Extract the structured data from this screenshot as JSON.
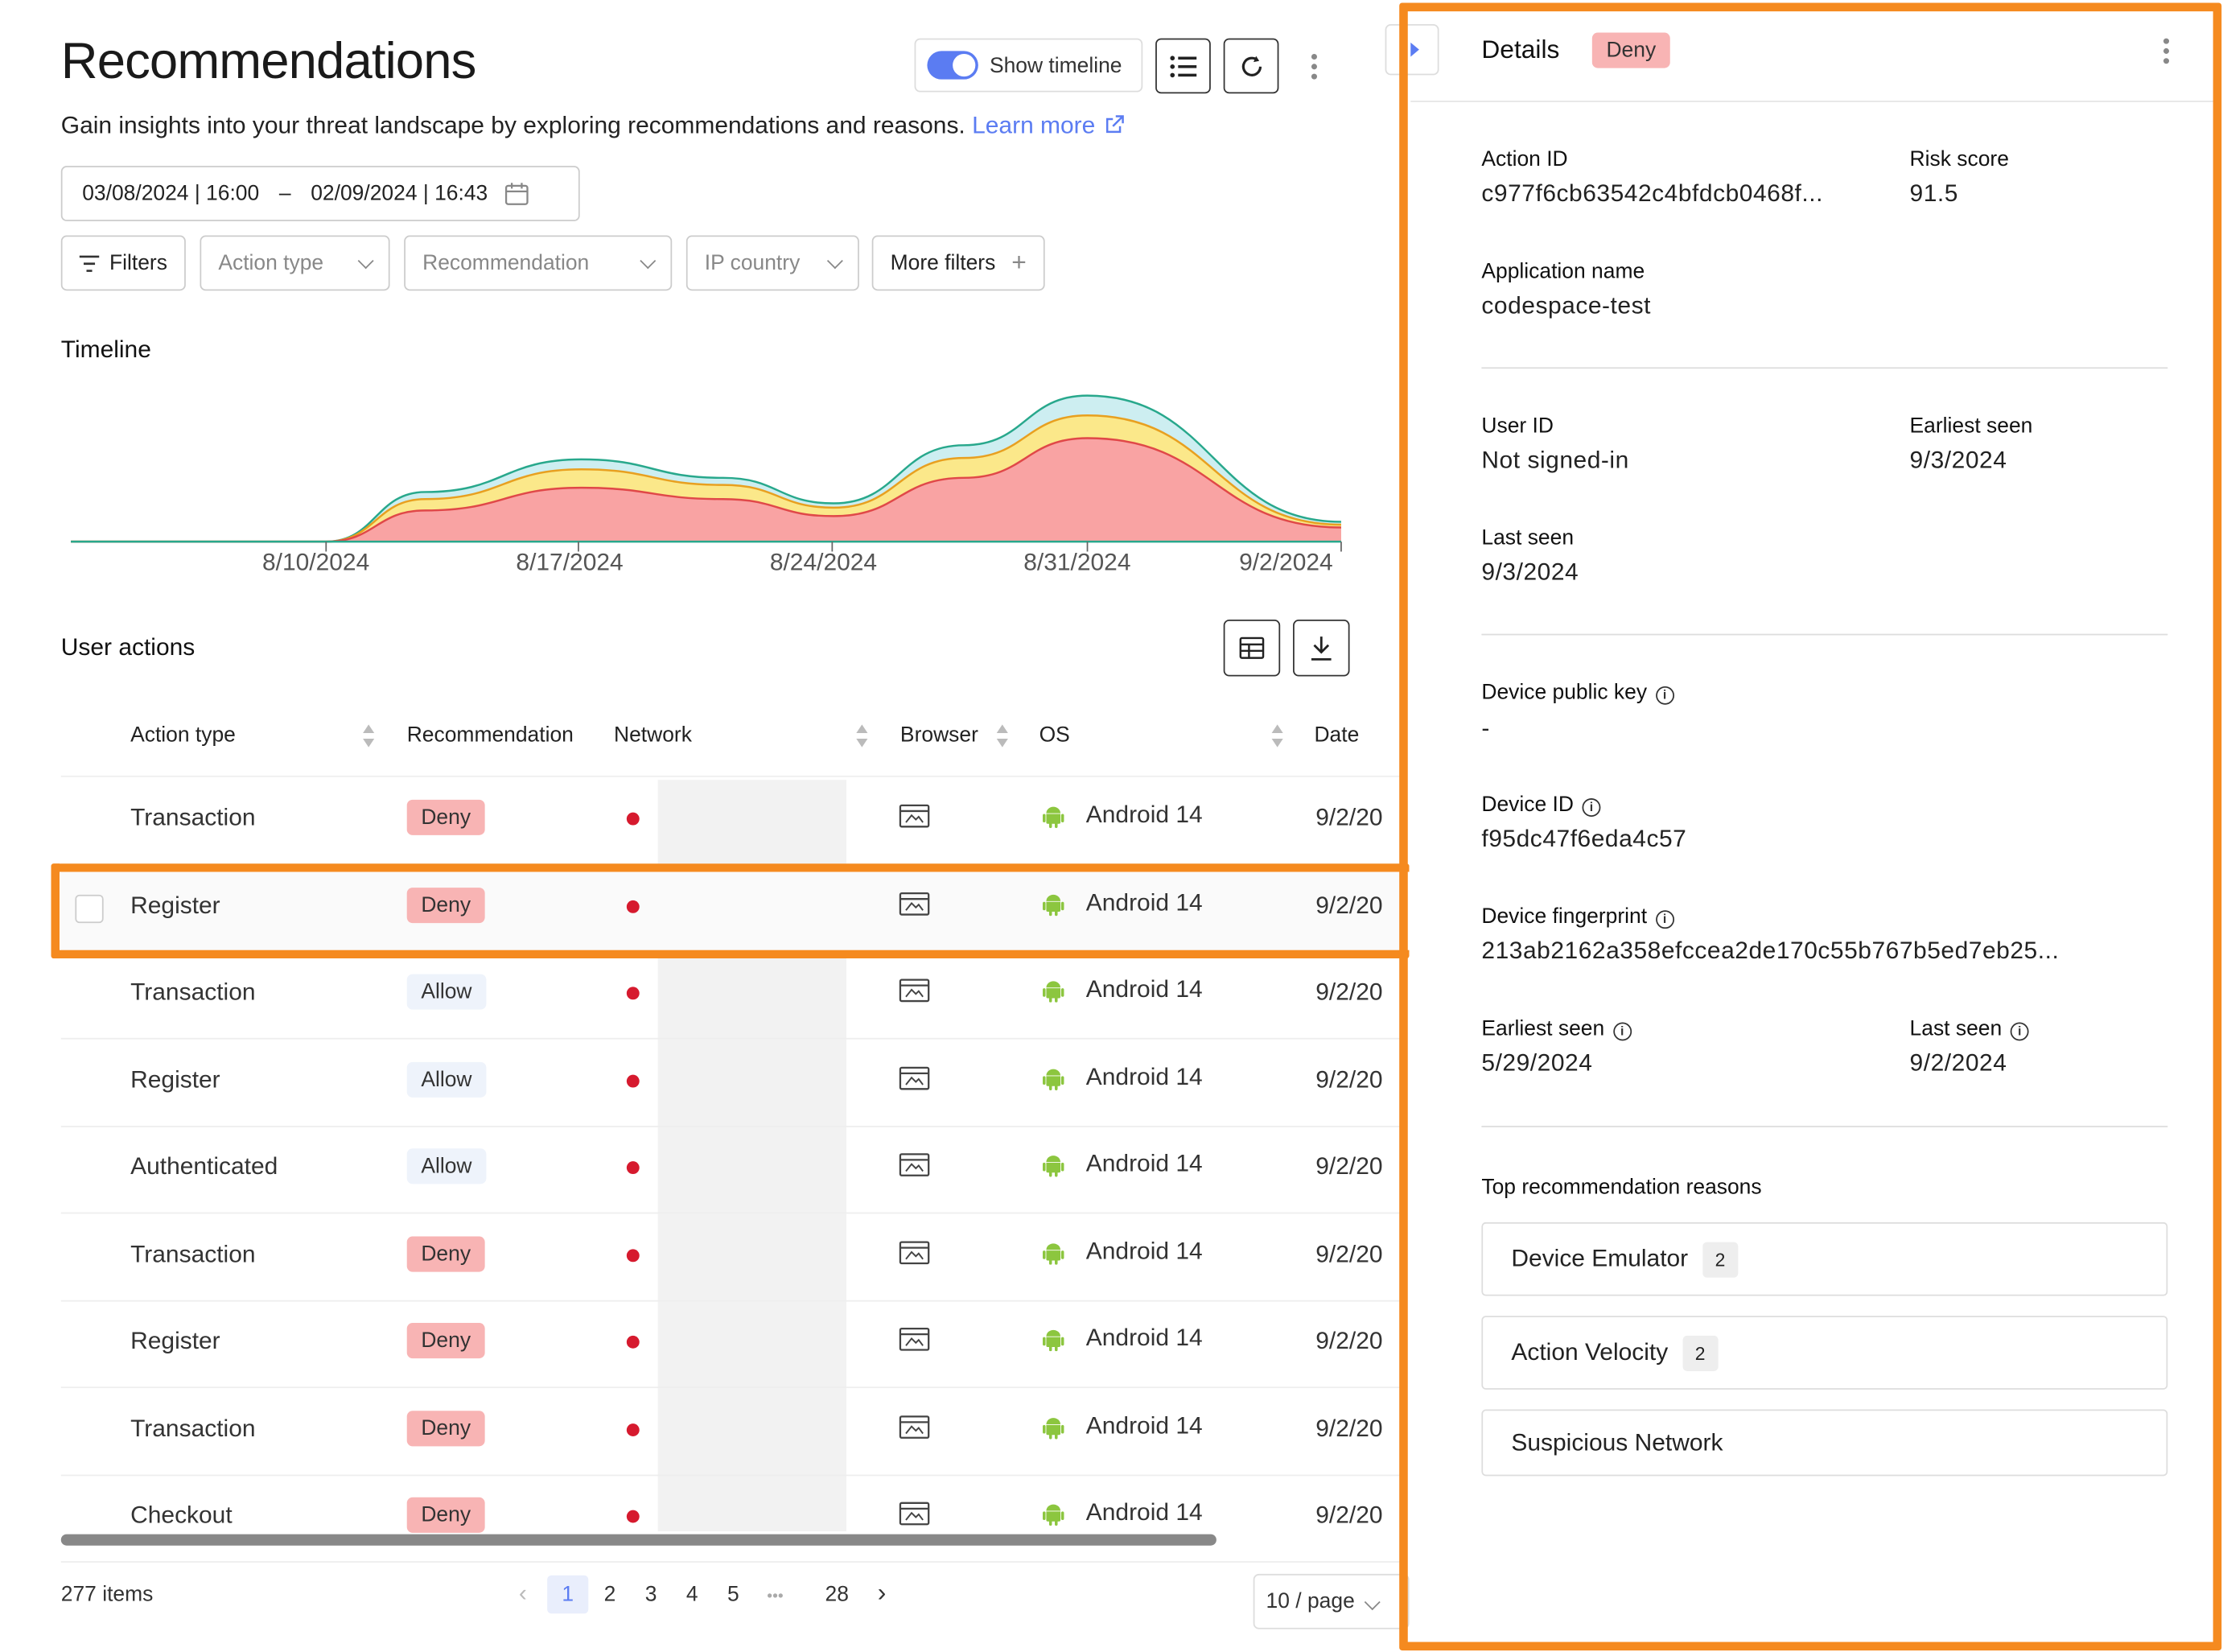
{
  "header": {
    "title": "Recommendations",
    "subtitle": "Gain insights into your threat landscape by exploring recommendations and reasons.",
    "learn_more": "Learn more",
    "show_timeline": "Show timeline"
  },
  "date_range": {
    "start": "03/08/2024 | 16:00",
    "separator": "–",
    "end": "02/09/2024 | 16:43"
  },
  "filters": {
    "filters_label": "Filters",
    "action_type": "Action type",
    "recommendation": "Recommendation",
    "ip_country": "IP country",
    "more_filters": "More filters"
  },
  "timeline": {
    "title": "Timeline",
    "ticks": [
      "8/10/2024",
      "8/17/2024",
      "8/24/2024",
      "8/31/2024",
      "9/2/2024"
    ]
  },
  "chart_data": {
    "type": "area",
    "x": [
      "8/3/2024",
      "8/10/2024",
      "8/13/2024",
      "8/17/2024",
      "8/20/2024",
      "8/24/2024",
      "8/27/2024",
      "8/31/2024",
      "9/2/2024"
    ],
    "series": [
      {
        "name": "",
        "color": "#f9a3a3",
        "values": [
          0,
          0,
          22,
          38,
          30,
          18,
          45,
          73,
          10
        ]
      },
      {
        "name": "",
        "color": "#fbe88a",
        "values": [
          0,
          0,
          8,
          13,
          10,
          6,
          14,
          16,
          2
        ]
      },
      {
        "name": "",
        "color": "#cdeef1",
        "values": [
          0,
          0,
          5,
          7,
          5,
          3,
          9,
          14,
          2
        ]
      }
    ],
    "stroke_colors": {
      "top": "#28a88c",
      "mid": "#e8a020",
      "bottom": "#e04848"
    }
  },
  "user_actions": {
    "title": "User actions",
    "columns": {
      "action_type": "Action type",
      "recommendation": "Recommendation",
      "network": "Network",
      "browser": "Browser",
      "os": "OS",
      "date": "Date"
    },
    "rows": [
      {
        "action": "Transaction",
        "rec": "Deny",
        "os": "Android 14",
        "date": "9/2/20"
      },
      {
        "action": "Register",
        "rec": "Deny",
        "os": "Android 14",
        "date": "9/2/20"
      },
      {
        "action": "Transaction",
        "rec": "Allow",
        "os": "Android 14",
        "date": "9/2/20"
      },
      {
        "action": "Register",
        "rec": "Allow",
        "os": "Android 14",
        "date": "9/2/20"
      },
      {
        "action": "Authenticated",
        "rec": "Allow",
        "os": "Android 14",
        "date": "9/2/20"
      },
      {
        "action": "Transaction",
        "rec": "Deny",
        "os": "Android 14",
        "date": "9/2/20"
      },
      {
        "action": "Register",
        "rec": "Deny",
        "os": "Android 14",
        "date": "9/2/20"
      },
      {
        "action": "Transaction",
        "rec": "Deny",
        "os": "Android 14",
        "date": "9/2/20"
      },
      {
        "action": "Checkout",
        "rec": "Deny",
        "os": "Android 14",
        "date": "9/2/20"
      }
    ]
  },
  "pagination": {
    "items": "277 items",
    "pages": [
      "1",
      "2",
      "3",
      "4",
      "5",
      "•••",
      "28"
    ],
    "per_page": "10 / page"
  },
  "details": {
    "title": "Details",
    "badge": "Deny",
    "action_id_label": "Action ID",
    "action_id": "c977f6cb63542c4bfdcb0468f...",
    "risk_score_label": "Risk score",
    "risk_score": "91.5",
    "app_name_label": "Application name",
    "app_name": "codespace-test",
    "user_id_label": "User ID",
    "user_id": "Not signed-in",
    "earliest_seen_label": "Earliest seen",
    "earliest_seen": "9/3/2024",
    "last_seen_label": "Last seen",
    "last_seen": "9/3/2024",
    "device_public_key_label": "Device public key",
    "device_public_key": "-",
    "device_id_label": "Device ID",
    "device_id": "f95dc47f6eda4c57",
    "device_fp_label": "Device fingerprint",
    "device_fp": "213ab2162a358efccea2de170c55b767b5ed7eb25...",
    "dev_earliest_label": "Earliest seen",
    "dev_earliest": "5/29/2024",
    "dev_last_label": "Last seen",
    "dev_last": "9/2/2024",
    "reasons_label": "Top recommendation reasons",
    "reasons": [
      {
        "name": "Device Emulator",
        "count": "2"
      },
      {
        "name": "Action Velocity",
        "count": "2"
      },
      {
        "name": "Suspicious Network",
        "count": ""
      }
    ]
  },
  "colors": {
    "accent": "#5b7cf2",
    "deny": "#f8b4b4",
    "allow": "#eef3fb",
    "highlight": "#f58a1f",
    "network_dot": "#d61a2e"
  }
}
